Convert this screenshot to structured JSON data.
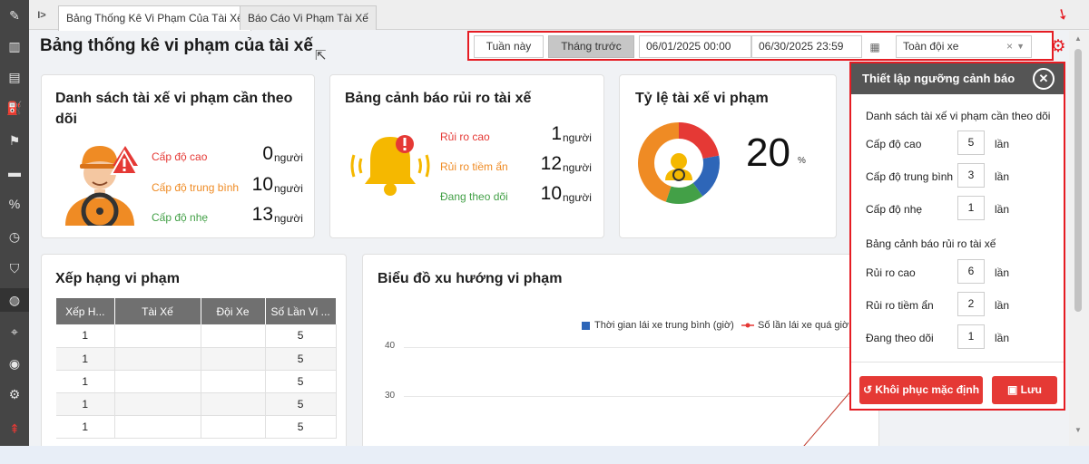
{
  "tabs": [
    {
      "label": "Bảng Thống Kê Vi Phạm Của Tài Xế",
      "active": true
    },
    {
      "label": "Báo Cáo Vi Phạm Tài Xế",
      "active": false
    }
  ],
  "page_title": "Bảng thống kê vi phạm của tài xế",
  "filter": {
    "this_week": "Tuần này",
    "last_month": "Tháng trước",
    "date_from": "06/01/2025 00:00",
    "date_to": "06/30/2025 23:59",
    "fleet": "Toàn đội xe",
    "fleet_clear": "×"
  },
  "driver_card": {
    "title": "Danh sách tài xế vi phạm cần theo dõi",
    "levels": [
      {
        "label": "Cấp độ cao",
        "value": "0",
        "unit": "người"
      },
      {
        "label": "Cấp độ trung bình",
        "value": "10",
        "unit": "người"
      },
      {
        "label": "Cấp độ nhẹ",
        "value": "13",
        "unit": "người"
      }
    ]
  },
  "risk_card": {
    "title": "Bảng cảnh báo rủi ro tài xế",
    "levels": [
      {
        "label": "Rủi ro cao",
        "value": "1",
        "unit": "người"
      },
      {
        "label": "Rủi ro tiềm ẩn",
        "value": "12",
        "unit": "người"
      },
      {
        "label": "Đang theo dõi",
        "value": "10",
        "unit": "người"
      }
    ]
  },
  "ratio_card": {
    "title": "Tỷ lệ tài xế vi phạm",
    "value": "20",
    "unit": "%",
    "donut_segments": [
      {
        "color": "#e53935",
        "share": 0.22
      },
      {
        "color": "#2e66b8",
        "share": 0.18
      },
      {
        "color": "#43a047",
        "share": 0.15
      },
      {
        "color": "#ef8b24",
        "share": 0.45
      }
    ]
  },
  "ranking": {
    "title": "Xếp hạng vi phạm",
    "columns": [
      "Xếp H...",
      "Tài Xế",
      "Đội Xe",
      "Số Lần Vi ..."
    ],
    "rows": [
      [
        "1",
        "",
        "",
        "5"
      ],
      [
        "1",
        "",
        "",
        "5"
      ],
      [
        "1",
        "",
        "",
        "5"
      ],
      [
        "1",
        "",
        "",
        "5"
      ],
      [
        "1",
        "",
        "",
        "5"
      ]
    ]
  },
  "trend": {
    "title": "Biểu đồ xu hướng vi phạm",
    "legend_bar": "Thời gian lái xe trung bình (giờ)",
    "legend_line": "Số lần lái xe quá giờ",
    "ticks": [
      "40",
      "30"
    ]
  },
  "settings": {
    "title": "Thiết lập ngưỡng cảnh báo",
    "section1": "Danh sách tài xế vi phạm cần theo dõi",
    "section1_rows": [
      {
        "label": "Cấp độ cao",
        "value": "5",
        "unit": "lần"
      },
      {
        "label": "Cấp độ trung bình",
        "value": "3",
        "unit": "lần"
      },
      {
        "label": "Cấp độ nhẹ",
        "value": "1",
        "unit": "lần"
      }
    ],
    "section2": "Bảng cảnh báo rủi ro tài xế",
    "section2_rows": [
      {
        "label": "Rủi ro cao",
        "value": "6",
        "unit": "lần"
      },
      {
        "label": "Rủi ro tiềm ẩn",
        "value": "2",
        "unit": "lần"
      },
      {
        "label": "Đang theo dõi",
        "value": "1",
        "unit": "lần"
      }
    ],
    "reset_label": "Khôi phục mặc định",
    "save_label": "Lưu"
  },
  "colors": {
    "accent_red": "#e51c23",
    "high": "#e53935",
    "medium": "#ef8b24",
    "low": "#43a047",
    "sidebar": "#454545"
  }
}
